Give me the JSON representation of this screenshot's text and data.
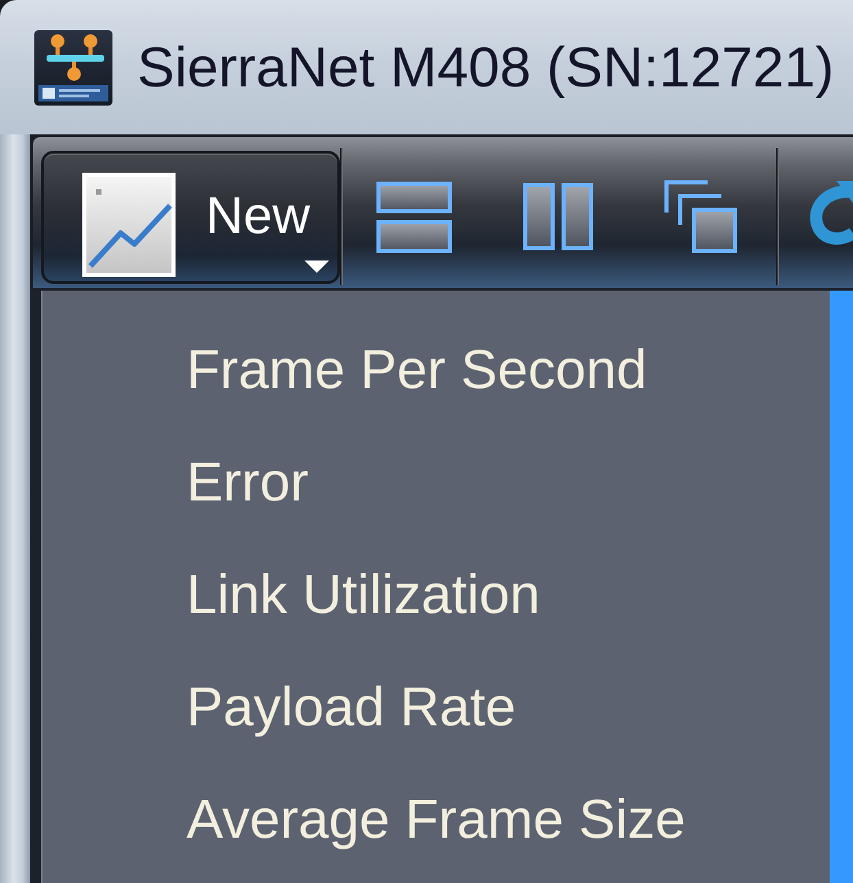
{
  "window": {
    "title": "SierraNet M408 (SN:12721)"
  },
  "toolbar": {
    "new_button": {
      "label": "New",
      "expanded": true
    }
  },
  "new_menu": {
    "items": [
      {
        "label": "Frame Per Second"
      },
      {
        "label": "Error"
      },
      {
        "label": "Link Utilization"
      },
      {
        "label": "Payload Rate"
      },
      {
        "label": "Average Frame Size"
      }
    ]
  }
}
